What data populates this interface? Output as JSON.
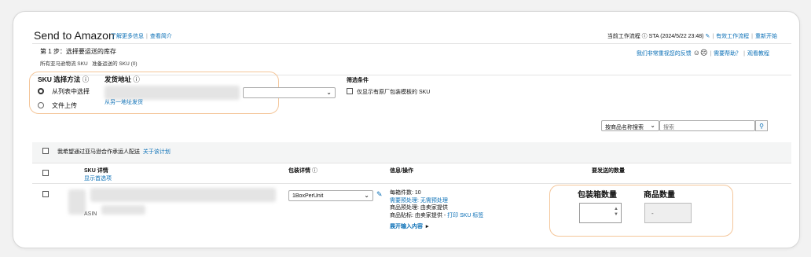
{
  "header": {
    "title": "Send to Amazon",
    "learn_more": "了解更多信息",
    "view_intro": "查看简介",
    "current_workflow": "当前工作流程 ⓘ STA (2024/5/22 23:48)",
    "active_workflows": "有效工作流程",
    "restart": "重新开始"
  },
  "step": {
    "title": "第 1 步：选择要运送的库存",
    "sub_all": "所有亚马逊物流 SKU",
    "sub_ready": "准备运送的 SKU (0)",
    "feedback": "我们非常重视您的反馈",
    "need_help": "需要帮助？",
    "view_tutorial": "观看教程"
  },
  "method": {
    "label": "SKU 选择方法",
    "option_list": "从列表中选择",
    "option_upload": "文件上传"
  },
  "ship_from": {
    "label": "发货地址",
    "ship_other": "从另一地址发货"
  },
  "filter": {
    "label": "筛选条件",
    "only_manufacturer": "仅显示有原厂包装模板的 SKU"
  },
  "search": {
    "sort_label": "按商品名称搜索",
    "placeholder": "搜索"
  },
  "partner": {
    "label": "我希望通过亚马逊合作承运人配送",
    "about": "关于该计划"
  },
  "table": {
    "col_sku": "SKU 详情",
    "show_options": "显示首选项",
    "col_packing": "包装详情",
    "col_info": "信息/操作",
    "col_qty": "要发送的数量",
    "row": {
      "asin_label": "ASIN",
      "packing_value": "1BoxPerUnit",
      "units_per_box": "每箱件数: 10",
      "prep_line": "需要预处理: 无需预处理",
      "item_prep": "商品预处理:",
      "item_prep_by": "由卖家提供",
      "item_label": "商品贴标:",
      "item_label_by": "由卖家提供",
      "print_label": "打印 SKU 标签",
      "expand": "展开输入内容",
      "box_qty_label": "包装箱数量",
      "unit_qty_label": "商品数量",
      "unit_qty_value": "-"
    }
  },
  "colors": {
    "link": "#0a6fb6",
    "highlight": "#f4c69a"
  }
}
